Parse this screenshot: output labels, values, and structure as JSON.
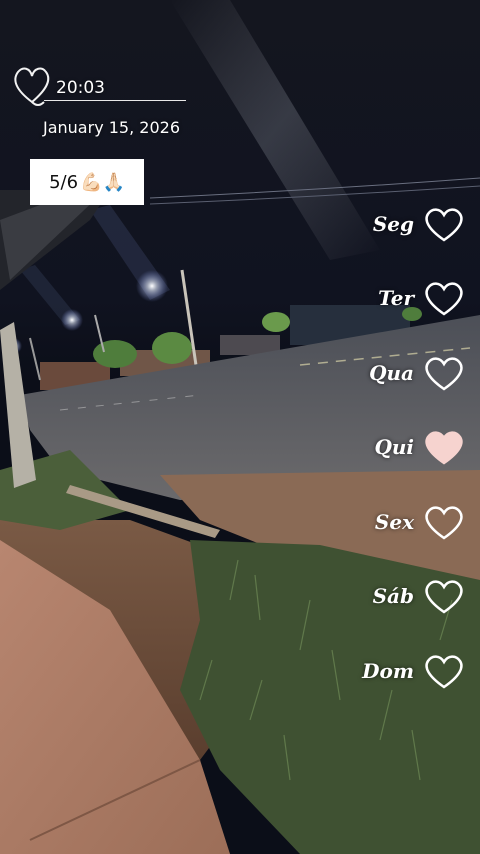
{
  "story": {
    "time": "20:03",
    "date": "January 15, 2026",
    "progress": {
      "text": "5/6",
      "emoji": "💪🏻🙏🏻"
    }
  },
  "week": {
    "days": [
      {
        "label": "Seg",
        "filled": false
      },
      {
        "label": "Ter",
        "filled": false
      },
      {
        "label": "Qua",
        "filled": false
      },
      {
        "label": "Qui",
        "filled": true
      },
      {
        "label": "Sex",
        "filled": false
      },
      {
        "label": "Sáb",
        "filled": false
      },
      {
        "label": "Dom",
        "filled": false
      }
    ],
    "filled_color": "#f6d3cf",
    "outline_color": "#ffffff"
  }
}
